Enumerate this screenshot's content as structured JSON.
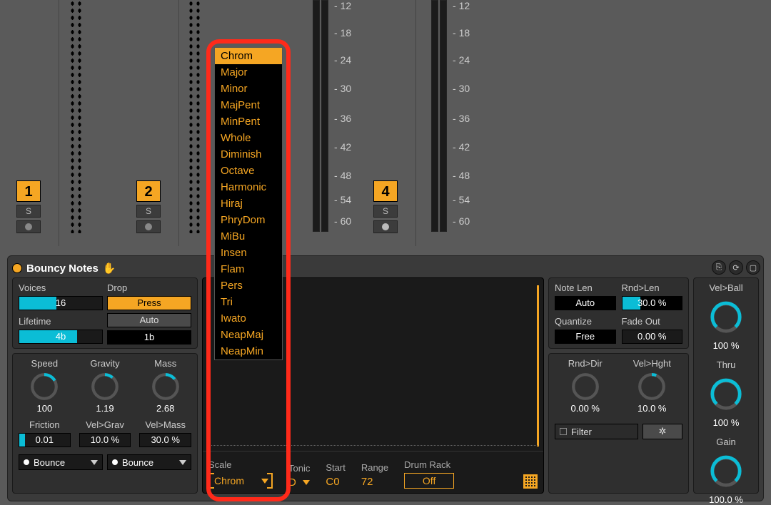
{
  "mixer": {
    "tracks": [
      {
        "num": "1",
        "solo": "S"
      },
      {
        "num": "2",
        "solo": "S"
      },
      {
        "num": "4",
        "solo": "S"
      }
    ],
    "scale_marks": [
      "12",
      "18",
      "24",
      "30",
      "36",
      "42",
      "48",
      "54",
      "60"
    ]
  },
  "device": {
    "title": "Bouncy Notes",
    "left": {
      "voices_label": "Voices",
      "voices_value": "16",
      "lifetime_label": "Lifetime",
      "lifetime_value": "4b",
      "drop_label": "Drop",
      "drop_press": "Press",
      "drop_auto": "Auto",
      "drop_1b": "1b",
      "speed_label": "Speed",
      "speed_val": "100",
      "gravity_label": "Gravity",
      "gravity_val": "1.19",
      "mass_label": "Mass",
      "mass_val": "2.68",
      "friction_label": "Friction",
      "friction_val": "0.01",
      "velgrav_label": "Vel>Grav",
      "velgrav_val": "10.0 %",
      "velmass_label": "Vel>Mass",
      "velmass_val": "30.0 %",
      "bounce_a": "Bounce",
      "bounce_b": "Bounce"
    },
    "bottom": {
      "scale_label": "Scale",
      "scale_value": "Chrom",
      "tonic_label": "Tonic",
      "tonic_value": "D",
      "start_label": "Start",
      "start_value": "C0",
      "range_label": "Range",
      "range_value": "72",
      "drumrack_label": "Drum Rack",
      "drumrack_value": "Off"
    },
    "right": {
      "notelen_label": "Note Len",
      "notelen_val": "Auto",
      "rndlen_label": "Rnd>Len",
      "rndlen_val": "30.0 %",
      "quant_label": "Quantize",
      "quant_val": "Free",
      "fade_label": "Fade Out",
      "fade_val": "0.00 %",
      "rnddir_label": "Rnd>Dir",
      "rnddir_val": "0.00 %",
      "velhght_label": "Vel>Hght",
      "velhght_val": "10.0 %",
      "filter_label": "Filter",
      "star": "✲",
      "velball_label": "Vel>Ball",
      "velball_val": "100 %",
      "thru_label": "Thru",
      "thru_val": "100 %",
      "gain_label": "Gain",
      "gain_val": "100.0 %"
    }
  },
  "dropdown": {
    "items": [
      "Chrom",
      "Major",
      "Minor",
      "MajPent",
      "MinPent",
      "Whole",
      "Diminish",
      "Octave",
      "Harmonic",
      "Hiraj",
      "PhryDom",
      "MiBu",
      "Insen",
      "Flam",
      "Pers",
      "Tri",
      "Iwato",
      "NeapMaj",
      "NeapMin"
    ],
    "selected_index": 0
  }
}
